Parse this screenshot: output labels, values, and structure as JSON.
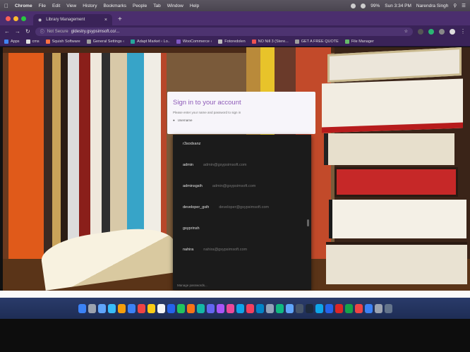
{
  "menubar": {
    "app_name": "Chrome",
    "items": [
      "File",
      "Edit",
      "View",
      "History",
      "Bookmarks",
      "People",
      "Tab",
      "Window",
      "Help"
    ],
    "battery": "99%",
    "clock": "Sun 3:34 PM",
    "user": "Narendra Singh"
  },
  "browser": {
    "tab_title": "Library Management",
    "address_security": "Not Secure",
    "address_url": "gldestry.gsypsimsoft.co/..."
  },
  "bookmarks": [
    {
      "label": "Apps",
      "color": "#4285f4"
    },
    {
      "label": "cms",
      "color": "#e0e0e0"
    },
    {
      "label": "Squish Software",
      "color": "#ff7043"
    },
    {
      "label": "General Settings ‹",
      "color": "#9e9e9e"
    },
    {
      "label": "Adapt Market ‹ Lo..",
      "color": "#26a69a"
    },
    {
      "label": "WooCommerce ‹",
      "color": "#7e57c2"
    },
    {
      "label": "Fotoredolen",
      "color": "#bdbdbd"
    },
    {
      "label": "NO Nill 3 (Stere...",
      "color": "#ef5350"
    },
    {
      "label": "GET A FREE QUOTE",
      "color": "#9e9e9e"
    },
    {
      "label": "File Manager",
      "color": "#66bb6a"
    }
  ],
  "signin": {
    "title": "Sign in to your account",
    "subtitle": "Please enter your name and password to sign in",
    "user_field": "Username"
  },
  "dropdown": {
    "items": [
      {
        "name": "r3sodxanz",
        "sub": ""
      },
      {
        "name": "admin",
        "sub": "admin@gsypsimsoft.com"
      },
      {
        "name": "adminsgsih",
        "sub": "admin@gsypsimsoft.com"
      },
      {
        "name": "developer_gsih",
        "sub": "developer@gsypsimsoft.com"
      },
      {
        "name": "gsyprinsh",
        "sub": ""
      },
      {
        "name": "nahira",
        "sub": "nahira@gsypsimsoft.com"
      }
    ],
    "footer": "Manage passwords..."
  },
  "dock_colors": [
    "#3b82f6",
    "#9ca3af",
    "#60a5fa",
    "#38bdf8",
    "#f59e0b",
    "#3b82f6",
    "#ef4444",
    "#facc15",
    "#f3f4f6",
    "#2563eb",
    "#22c55e",
    "#f97316",
    "#14b8a6",
    "#6366f1",
    "#a855f7",
    "#ec4899",
    "#0ea5e9",
    "#f43f5e",
    "#0284c7",
    "#94a3b8",
    "#10b981",
    "#60a5fa",
    "#475569",
    "#1e293b",
    "#0ea5e9",
    "#2563eb",
    "#dc2626",
    "#16a34a",
    "#ef4444",
    "#3b82f6",
    "#9ca3af",
    "#64748b"
  ]
}
